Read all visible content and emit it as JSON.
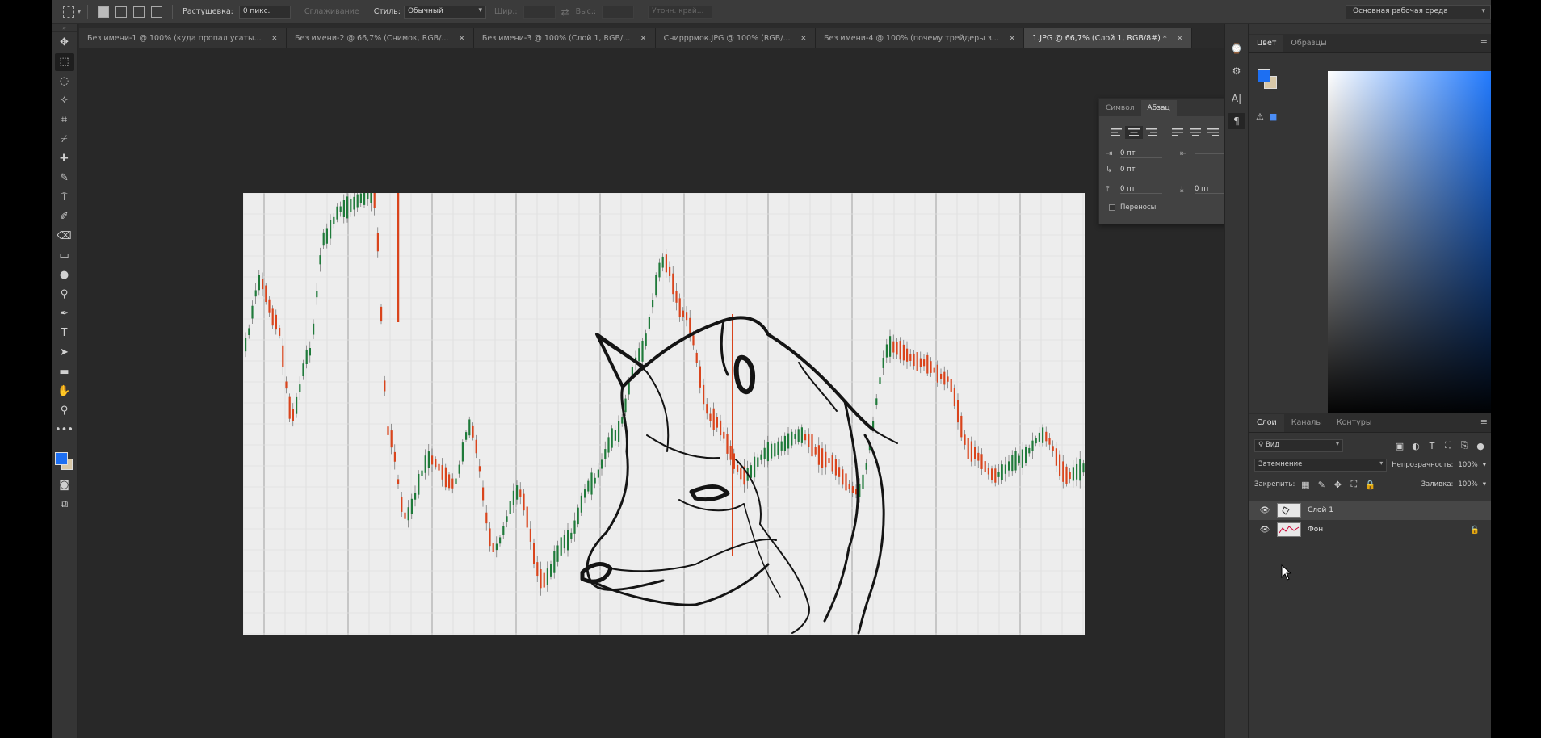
{
  "options_bar": {
    "feather_label": "Растушевка:",
    "feather_value": "0 пикс.",
    "antialias_label": "Сглаживание",
    "style_label": "Стиль:",
    "style_value": "Обычный",
    "width_label": "Шир.:",
    "height_label": "Выс.:",
    "refine_label": "Уточн. край...",
    "workspace": "Основная рабочая среда"
  },
  "tabs": [
    {
      "label": "Без имени-1 @ 100% (куда пропал усаты...",
      "active": false
    },
    {
      "label": "Без имени-2 @ 66,7% (Снимок, RGB/...",
      "active": false
    },
    {
      "label": "Без имени-3 @ 100% (Слой 1, RGB/...",
      "active": false
    },
    {
      "label": "Снирррмок.JPG @ 100% (RGB/...",
      "active": false
    },
    {
      "label": "Без имени-4 @ 100% (почему трейдеры з...",
      "active": false
    },
    {
      "label": "1.JPG @ 66,7% (Слой 1, RGB/8#) *",
      "active": true
    }
  ],
  "paragraph_panel": {
    "tab_character": "Символ",
    "tab_paragraph": "Абзац",
    "indent_left": "0 пт",
    "indent_right": "",
    "first_line": "0 пт",
    "space_before": "0 пт",
    "space_after": "0 пт",
    "hyphenate_label": "Переносы"
  },
  "color_panel": {
    "tab_color": "Цвет",
    "tab_swatches": "Образцы",
    "foreground": "#1d6ff2",
    "background": "#d8c8a8"
  },
  "layers_panel": {
    "tab_layers": "Слои",
    "tab_channels": "Каналы",
    "tab_paths": "Контуры",
    "filter_kind": "Вид",
    "blend_mode": "Затемнение",
    "opacity_label": "Непрозрачность:",
    "opacity_value": "100%",
    "lock_label": "Закрепить:",
    "fill_label": "Заливка:",
    "fill_value": "100%",
    "layers": [
      {
        "name": "Слой 1",
        "selected": true,
        "locked": false
      },
      {
        "name": "Фон",
        "selected": false,
        "locked": true
      }
    ]
  }
}
